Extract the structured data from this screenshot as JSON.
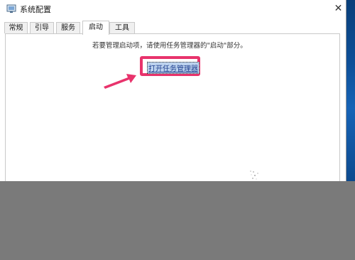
{
  "window": {
    "title": "系统配置",
    "close_glyph": "✕"
  },
  "tabs": [
    {
      "label": "常规",
      "active": false
    },
    {
      "label": "引导",
      "active": false
    },
    {
      "label": "服务",
      "active": false
    },
    {
      "label": "启动",
      "active": true
    },
    {
      "label": "工具",
      "active": false
    }
  ],
  "startup_panel": {
    "instruction": "若要管理启动项，请使用任务管理器的\"启动\"部分。",
    "link_label": "打开任务管理器"
  },
  "annotation": {
    "highlight_color": "#e8336c",
    "arrow_icon": "arrow-pointer-icon"
  },
  "colors": {
    "accent": "#e8336c",
    "link": "#1f3f8f",
    "background": "#7a7a7a"
  }
}
